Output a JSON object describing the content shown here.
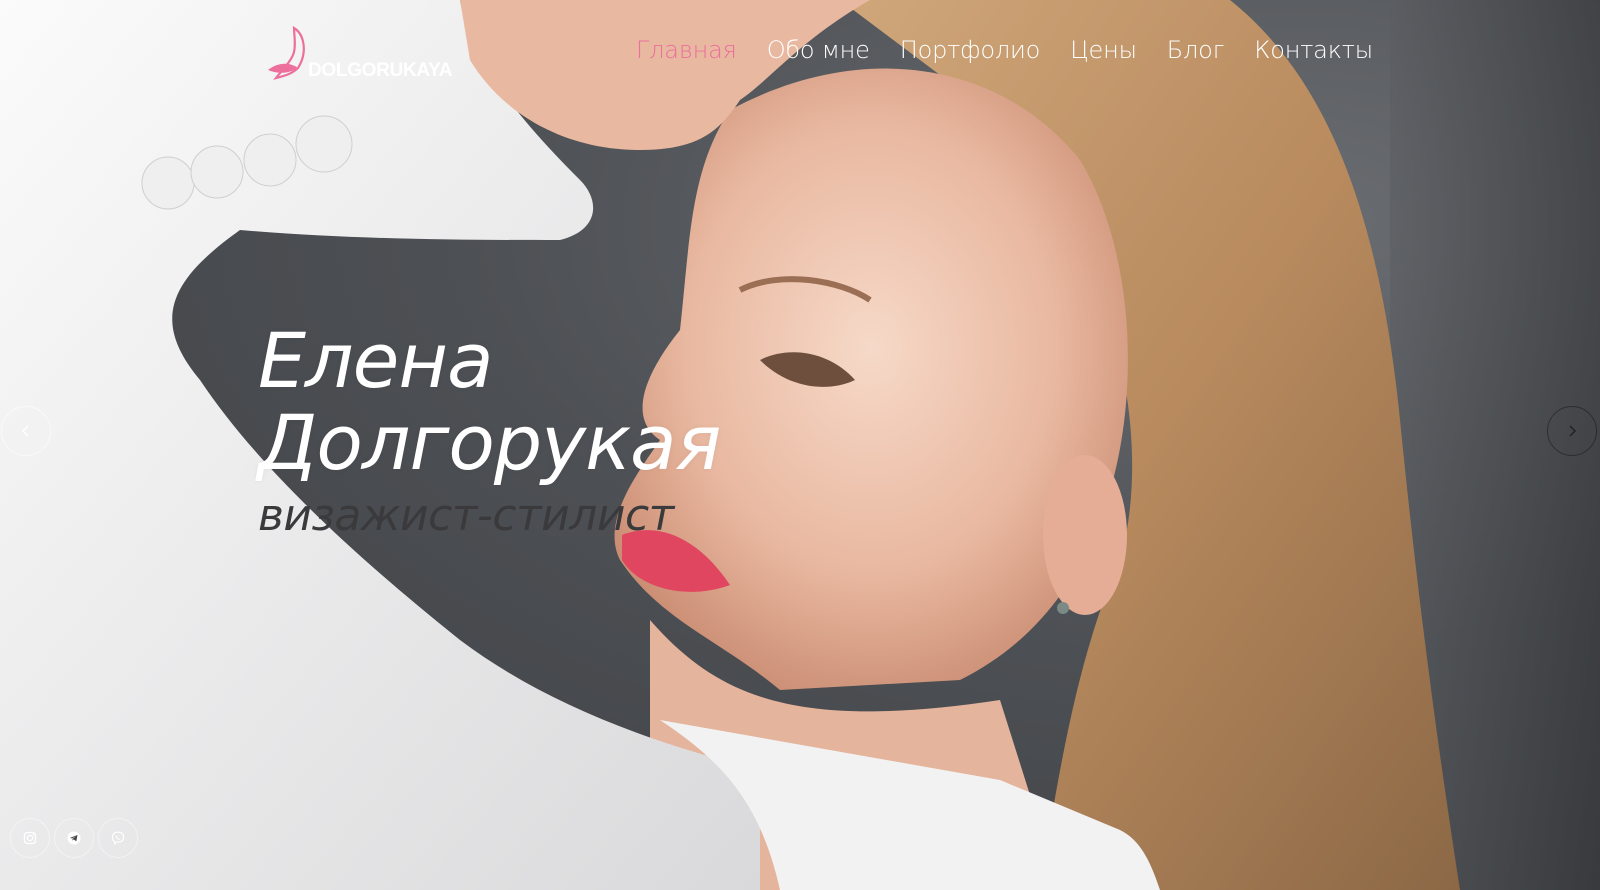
{
  "brand": {
    "logo_text": "DOLGORUKAYA",
    "accent_color": "#ec6f9c"
  },
  "nav": {
    "items": [
      {
        "label": "Главная",
        "active": true
      },
      {
        "label": "Обо мне",
        "active": false
      },
      {
        "label": "Портфолио",
        "active": false
      },
      {
        "label": "Цены",
        "active": false
      },
      {
        "label": "Блог",
        "active": false
      },
      {
        "label": "Контакты",
        "active": false
      }
    ]
  },
  "hero": {
    "title_line1": "Елена",
    "title_line2": "Долгорукая",
    "subtitle": "визажист-стилист"
  },
  "slider": {
    "prev_icon": "chevron-left-icon",
    "next_icon": "chevron-right-icon"
  },
  "socials": [
    {
      "icon": "instagram-icon"
    },
    {
      "icon": "telegram-icon"
    },
    {
      "icon": "viber-icon"
    }
  ]
}
